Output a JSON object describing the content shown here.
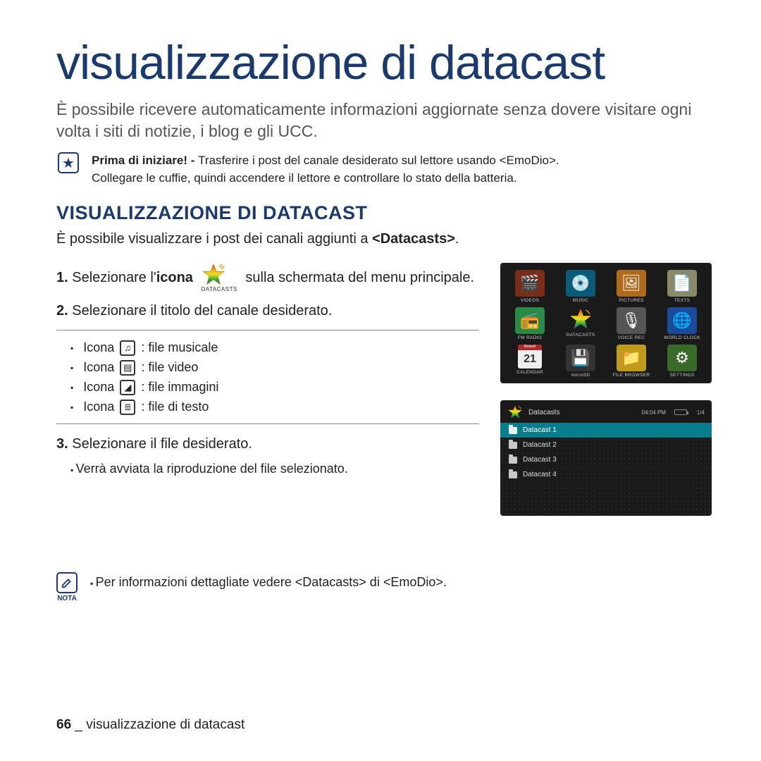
{
  "title": "visualizzazione di datacast",
  "intro": "È possibile ricevere automaticamente informazioni aggiornate senza dovere visitare ogni volta i siti di notizie, i blog e gli UCC.",
  "prima": {
    "label": "Prima di iniziare! - ",
    "text1": "Trasferire i post del canale desiderato sul lettore usando <EmoDio>.",
    "text2": "Collegare le cuffie, quindi accendere il lettore e controllare lo stato della batteria."
  },
  "section_heading": "VISUALIZZAZIONE DI DATACAST",
  "section_sub_a": "È possibile visualizzare i post dei canali aggiunti a ",
  "section_sub_b": "<Datacasts>",
  "section_sub_c": ".",
  "step1_a": "1.",
  "step1_b": " Selezionare l'",
  "step1_c": "icona",
  "step1_d": " sulla schermata del menu principale.",
  "inline_icon_label": "DATACASTS",
  "step2_a": "2.",
  "step2_b": " Selezionare il titolo del canale desiderato.",
  "icon_word": "Icona",
  "icon_types": {
    "music": ": file musicale",
    "video": ": file video",
    "image": ": file immagini",
    "text": ": file di testo"
  },
  "step3_a": "3.",
  "step3_b": " Selezionare il file desiderato.",
  "step3_sub": "Verrà avviata la riproduzione del file selezionato.",
  "note_label": "NOTA",
  "note_text": "Per informazioni dettagliate vedere <Datacasts> di <EmoDio>.",
  "footer_page": "66",
  "footer_sep": " _ ",
  "footer_text": "visualizzazione di datacast",
  "menu_apps": [
    {
      "label": "VIDEOS",
      "color": "#7a2e1a",
      "glyph": "🎬"
    },
    {
      "label": "MUSIC",
      "color": "#0a5a7a",
      "glyph": "💿"
    },
    {
      "label": "PICTURES",
      "color": "#b06a1a",
      "glyph": "🖼"
    },
    {
      "label": "TEXTS",
      "color": "#8a8a6a",
      "glyph": "📄"
    },
    {
      "label": "FM RADIO",
      "color": "#2a8a4a",
      "glyph": "📻"
    },
    {
      "label": "DATACASTS",
      "color": "#1a1a1a",
      "glyph": "★"
    },
    {
      "label": "VOICE REC",
      "color": "#555",
      "glyph": "🎙"
    },
    {
      "label": "WORLD CLOCK",
      "color": "#1a4a9a",
      "glyph": "🌐"
    },
    {
      "label": "CALENDAR",
      "color": "#aa2a2a",
      "glyph": "21"
    },
    {
      "label": "microSD",
      "color": "#333",
      "glyph": "💾"
    },
    {
      "label": "FILE BROWSER",
      "color": "#c09a1a",
      "glyph": "📁"
    },
    {
      "label": "SETTINGS",
      "color": "#3a6a2a",
      "glyph": "⚙"
    }
  ],
  "dc_screen": {
    "title": "Datacasts",
    "time": "04:04 PM",
    "counter": "1/4",
    "items": [
      "Datacast 1",
      "Datacast 2",
      "Datacast 3",
      "Datacast 4"
    ],
    "selected_index": 0
  }
}
